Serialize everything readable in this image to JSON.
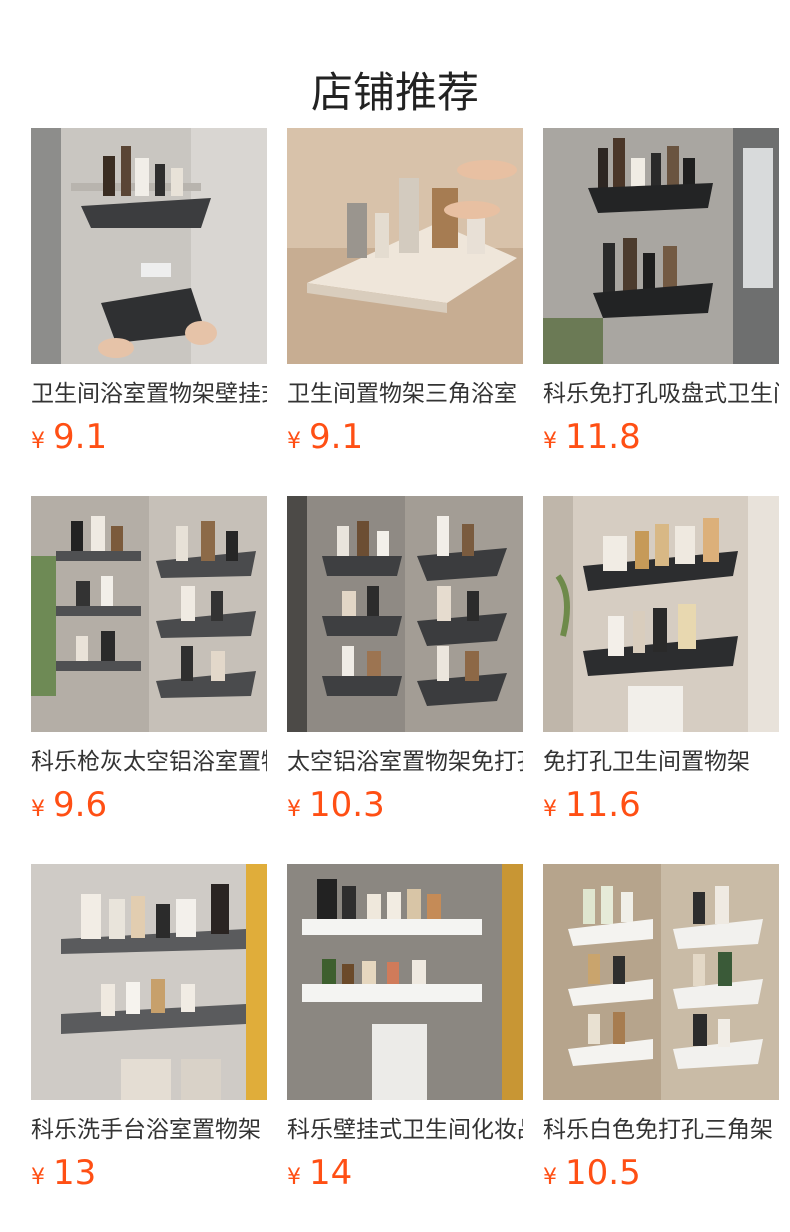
{
  "section": {
    "title": "店铺推荐"
  },
  "currency_symbol": "¥",
  "price_color": "#ff4f14",
  "products": [
    {
      "name": "卫生间浴室置物架壁挂式",
      "price": "9.1",
      "image": "dark-corner-shelf-image",
      "theme": "dark"
    },
    {
      "name": "卫生间置物架三角浴室",
      "price": "9.1",
      "image": "white-corner-shelf-image",
      "theme": "beige"
    },
    {
      "name": "科乐免打孔吸盘式卫生间",
      "price": "11.8",
      "image": "black-double-rack-image",
      "theme": "dark"
    },
    {
      "name": "科乐枪灰太空铝浴室置物架",
      "price": "9.6",
      "image": "gray-multi-tier-rack-image",
      "theme": "gray"
    },
    {
      "name": "太空铝浴室置物架免打孔",
      "price": "10.3",
      "image": "corner-tier-rack-image",
      "theme": "gray"
    },
    {
      "name": "免打孔卫生间置物架",
      "price": "11.6",
      "image": "hook-towel-rack-image",
      "theme": "beige"
    },
    {
      "name": "科乐洗手台浴室置物架",
      "price": "13",
      "image": "gray-wall-rack-image",
      "theme": "gray"
    },
    {
      "name": "科乐壁挂式卫生间化妆品",
      "price": "14",
      "image": "white-wall-rack-image",
      "theme": "marble"
    },
    {
      "name": "科乐白色免打孔三角架",
      "price": "10.5",
      "image": "white-tier-rack-image",
      "theme": "beige"
    }
  ]
}
